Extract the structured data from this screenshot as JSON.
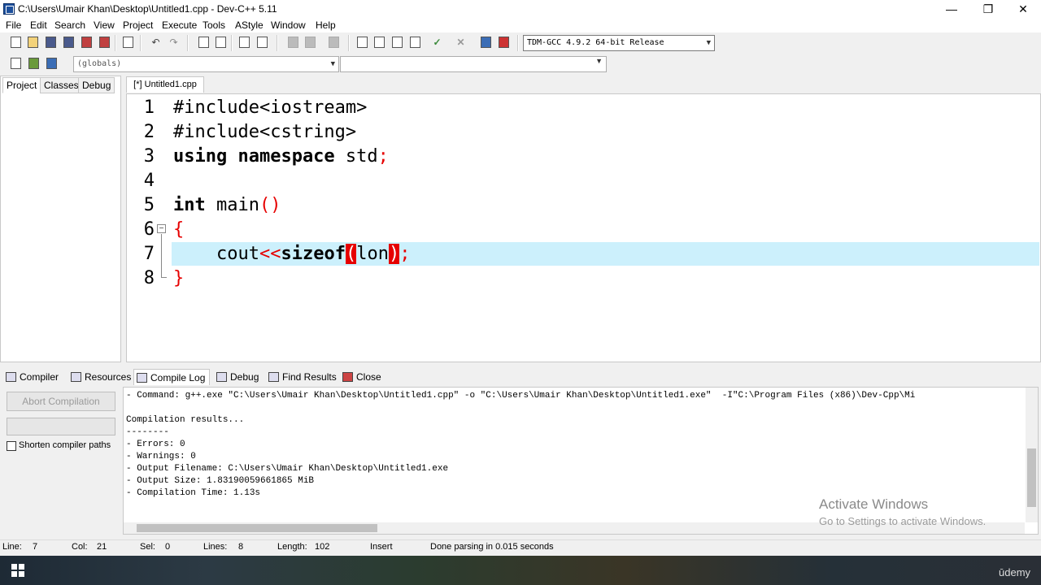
{
  "window": {
    "title": "C:\\Users\\Umair Khan\\Desktop\\Untitled1.cpp - Dev-C++ 5.11",
    "controls": {
      "minimize": "—",
      "restore": "❐",
      "close": "✕"
    }
  },
  "menu": [
    "File",
    "Edit",
    "Search",
    "View",
    "Project",
    "Execute",
    "Tools",
    "AStyle",
    "Window",
    "Help"
  ],
  "toolbar": {
    "compiler_select": "TDM-GCC 4.9.2 64-bit Release",
    "scope_select": "(globals)"
  },
  "left_tabs": [
    "Project",
    "Classes",
    "Debug"
  ],
  "editor": {
    "tab_label": "[*] Untitled1.cpp",
    "line_numbers": [
      "1",
      "2",
      "3",
      "4",
      "5",
      "6",
      "7",
      "8"
    ],
    "lines": {
      "l1": "#include<iostream>",
      "l2": "#include<cstring>",
      "l3_kw": "using namespace",
      "l3_rest": " std",
      "l3_semi": ";",
      "l5_kw": "int",
      "l5_rest": " main",
      "l5_parens": "()",
      "l6": "{",
      "l7_indent": "    ",
      "l7_cout": "cout",
      "l7_op": "<<",
      "l7_sizeof": "sizeof",
      "l7_open": "(",
      "l7_arg": "lon",
      "l7_close": ")",
      "l7_semi": ";",
      "l8": "}"
    }
  },
  "bottom_tabs": [
    "Compiler",
    "Resources",
    "Compile Log",
    "Debug",
    "Find Results",
    "Close"
  ],
  "compile_panel": {
    "abort_label": "Abort Compilation",
    "shorten_label": "Shorten compiler paths"
  },
  "log": [
    "- Command: g++.exe \"C:\\Users\\Umair Khan\\Desktop\\Untitled1.cpp\" -o \"C:\\Users\\Umair Khan\\Desktop\\Untitled1.exe\"  -I\"C:\\Program Files (x86)\\Dev-Cpp\\Mi",
    "",
    "Compilation results...",
    "--------",
    "- Errors: 0",
    "- Warnings: 0",
    "- Output Filename: C:\\Users\\Umair Khan\\Desktop\\Untitled1.exe",
    "- Output Size: 1.83190059661865 MiB",
    "- Compilation Time: 1.13s"
  ],
  "watermark": {
    "line1": "Activate Windows",
    "line2": "Go to Settings to activate Windows."
  },
  "status": {
    "line_label": "Line:",
    "line_val": "7",
    "col_label": "Col:",
    "col_val": "21",
    "sel_label": "Sel:",
    "sel_val": "0",
    "lines_label": "Lines:",
    "lines_val": "8",
    "length_label": "Length:",
    "length_val": "102",
    "mode": "Insert",
    "message": "Done parsing in 0.015 seconds"
  },
  "taskbar": {
    "brand": "ūdemy"
  }
}
